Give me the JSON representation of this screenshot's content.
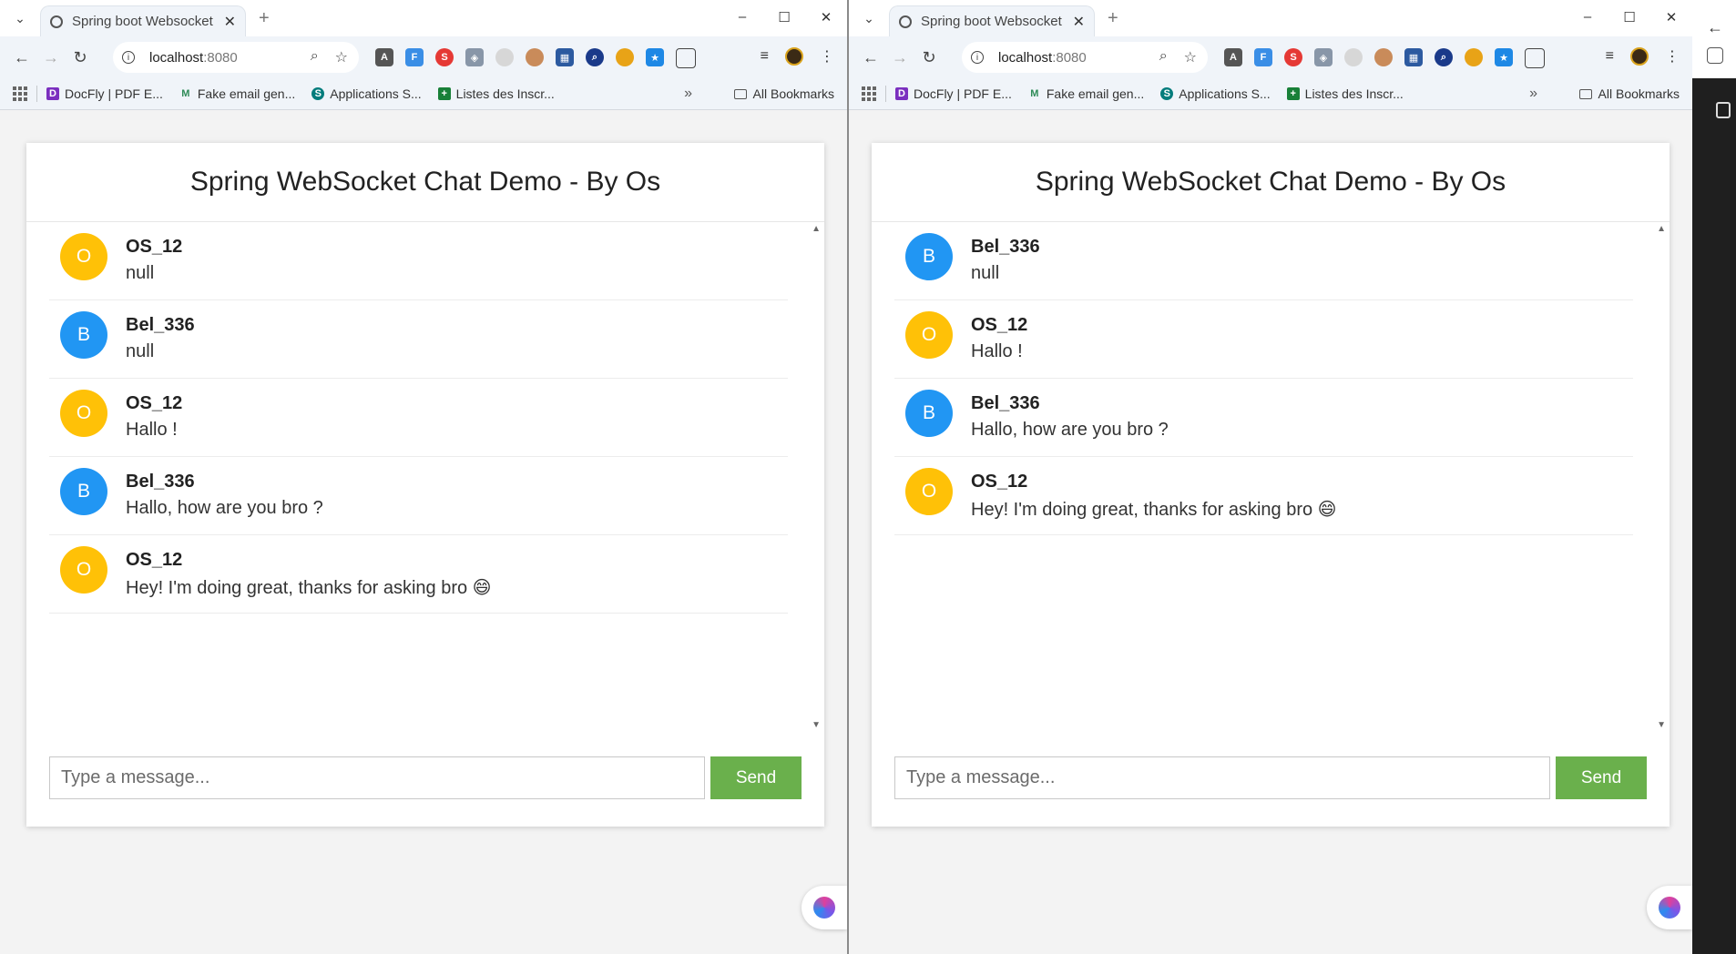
{
  "browser": {
    "tab_title": "Spring boot Websocket C",
    "url_host": "localhost",
    "url_port": ":8080",
    "bookmarks": [
      {
        "label": "DocFly | PDF E...",
        "icon": "docfly-icon",
        "color": "#7b2fbf"
      },
      {
        "label": "Fake email gen...",
        "icon": "fake-email-icon",
        "color": "#2e8b57"
      },
      {
        "label": "Applications  S...",
        "icon": "sharepoint-icon",
        "color": "#037c7c"
      },
      {
        "label": "Listes des Inscr...",
        "icon": "sheets-icon",
        "color": "#188038"
      }
    ],
    "bookmarks_more": "»",
    "all_bookmarks": "All Bookmarks"
  },
  "chat": {
    "title": "Spring WebSocket Chat Demo - By Os",
    "input_placeholder": "Type a message...",
    "send_label": "Send"
  },
  "colors": {
    "avatar_o": "#ffc107",
    "avatar_b": "#2196f3",
    "send_button": "#6ab04c"
  },
  "left_window": {
    "messages": [
      {
        "initial": "O",
        "sender": "OS_12",
        "text": "null"
      },
      {
        "initial": "B",
        "sender": "Bel_336",
        "text": "null"
      },
      {
        "initial": "O",
        "sender": "OS_12",
        "text": "Hallo !"
      },
      {
        "initial": "B",
        "sender": "Bel_336",
        "text": "Hallo, how are you bro ?"
      },
      {
        "initial": "O",
        "sender": "OS_12",
        "text": "Hey! I'm doing great, thanks for asking bro 😄"
      }
    ]
  },
  "right_window": {
    "messages": [
      {
        "initial": "B",
        "sender": "Bel_336",
        "text": "null"
      },
      {
        "initial": "O",
        "sender": "OS_12",
        "text": "Hallo !"
      },
      {
        "initial": "B",
        "sender": "Bel_336",
        "text": "Hallo, how are you bro ?"
      },
      {
        "initial": "O",
        "sender": "OS_12",
        "text": "Hey! I'm doing great, thanks for asking bro 😄"
      }
    ]
  }
}
